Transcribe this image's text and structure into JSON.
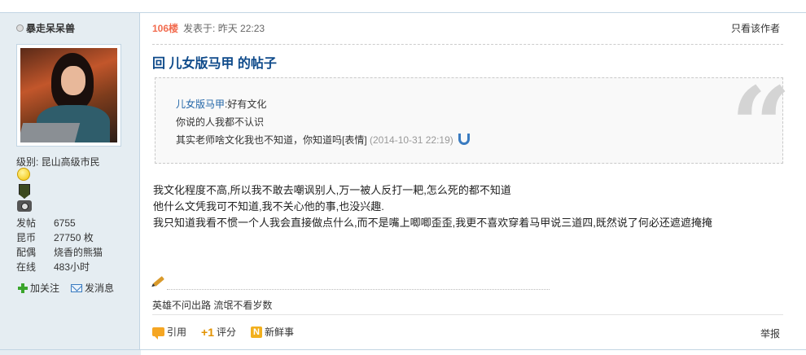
{
  "user": {
    "name": "暴走呆呆兽",
    "level": "级别: 昆山高级市民",
    "stats": [
      {
        "key": "发帖",
        "value": "6755"
      },
      {
        "key": "昆币",
        "value": "27750 枚"
      },
      {
        "key": "配偶",
        "value": "烧香的熊猫"
      },
      {
        "key": "在线",
        "value": "483小时"
      }
    ],
    "actions": {
      "follow": "加关注",
      "message": "发消息"
    }
  },
  "post": {
    "floor": "106楼",
    "posted_at": "发表于: 昨天 22:23",
    "only_author": "只看该作者",
    "title": "回 儿女版马甲 的帖子",
    "quote": {
      "author": "儿女版马甲",
      "author_suffix": ":好有文化",
      "line2": "你说的人我都不认识",
      "line3": "其实老师啥文化我也不知道，你知道吗[表情]",
      "time": "(2014-10-31 22:19)"
    },
    "body": [
      "我文化程度不高,所以我不敢去嘲讽别人,万一被人反打一耙,怎么死的都不知道",
      "他什么文凭我可不知道,我不关心他的事,也没兴趣.",
      "我只知道我看不惯一个人我会直接做点什么,而不是嘴上唧唧歪歪,我更不喜欢穿着马甲说三道四,既然说了何必还遮遮掩掩"
    ],
    "signature": "英雄不问出路 流氓不看岁数",
    "actions": {
      "quote": "引用",
      "rate": "评分",
      "fresh": "新鲜事",
      "report": "举报"
    }
  }
}
